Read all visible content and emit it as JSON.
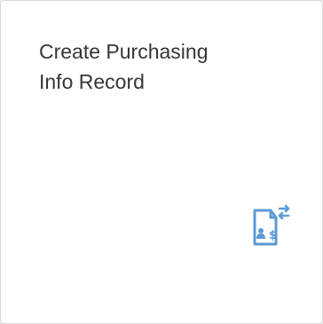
{
  "tile": {
    "title_line1": "Create Purchasing",
    "title_line2": "Info Record",
    "icon": "purchasing-info-record-icon",
    "accent_color": "#5b9ad5",
    "background_color": "#ffffff",
    "text_color": "#32363a"
  }
}
